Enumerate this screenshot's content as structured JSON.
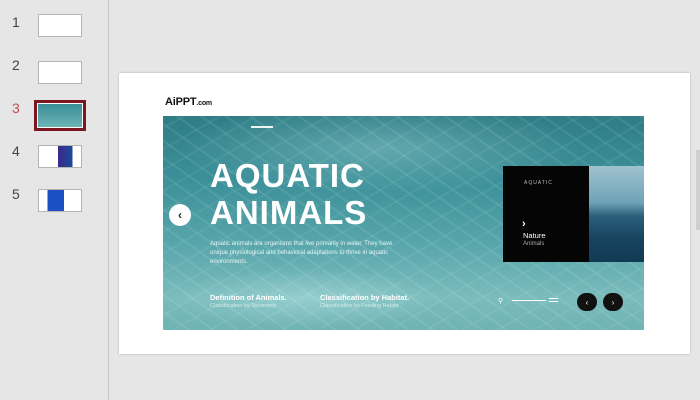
{
  "slides": [
    {
      "num": "1",
      "active": false
    },
    {
      "num": "2",
      "active": false
    },
    {
      "num": "3",
      "active": true
    },
    {
      "num": "4",
      "active": false
    },
    {
      "num": "5",
      "active": false
    }
  ],
  "logo": {
    "main": "AiPPT",
    "suffix": ".com"
  },
  "hero": {
    "title_line1": "AQUATIC",
    "title_line2": "ANIMALS",
    "description": "Aquatic animals are organisms that live primarily in water. They have unique physiological and behavioral adaptations to thrive in aquatic environments.",
    "section1_title": "Definition of Animals.",
    "section1_sub": "Classification by Taxonomy",
    "section2_title": "Classification by Habitat.",
    "section2_sub": "Classification by Feeding Habits",
    "prev_icon": "‹",
    "next_icon": "›"
  },
  "card": {
    "label": "AQUATIC",
    "chevron": "›",
    "title": "Nature",
    "subtitle": "Animals"
  },
  "nav": {
    "prev": "‹",
    "next": "›"
  },
  "colors": {
    "active_slide_num": "#c0504d",
    "selected_border": "#7b1620"
  }
}
